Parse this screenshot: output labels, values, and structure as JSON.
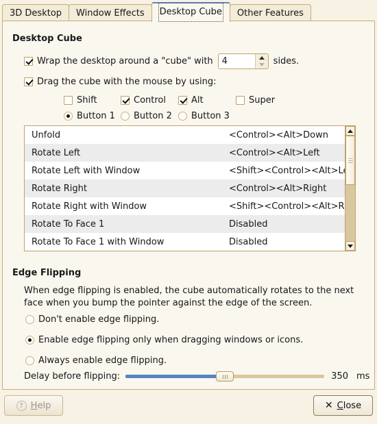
{
  "tabs": [
    {
      "label": "3D Desktop",
      "active": false
    },
    {
      "label": "Window Effects",
      "active": false
    },
    {
      "label": "Desktop Cube",
      "active": true
    },
    {
      "label": "Other Features",
      "active": false
    }
  ],
  "cube_group": {
    "title": "Desktop Cube",
    "wrap": {
      "checked": true,
      "label_before": "Wrap the desktop around a \"cube\" with",
      "sides_value": "4",
      "label_after": "sides."
    },
    "drag": {
      "checked": true,
      "label": "Drag the cube with the mouse by using:"
    },
    "modifiers": [
      {
        "label": "Shift",
        "checked": false
      },
      {
        "label": "Control",
        "checked": true
      },
      {
        "label": "Alt",
        "checked": true
      },
      {
        "label": "Super",
        "checked": false
      }
    ],
    "buttons": [
      {
        "label": "Button 1",
        "selected": true
      },
      {
        "label": "Button 2",
        "selected": false
      },
      {
        "label": "Button 3",
        "selected": false
      }
    ],
    "shortcuts": [
      {
        "action": "Unfold",
        "binding": "<Control><Alt>Down"
      },
      {
        "action": "Rotate Left",
        "binding": "<Control><Alt>Left"
      },
      {
        "action": "Rotate Left with Window",
        "binding": "<Shift><Control><Alt>Left"
      },
      {
        "action": "Rotate Right",
        "binding": "<Control><Alt>Right"
      },
      {
        "action": "Rotate Right with Window",
        "binding": "<Shift><Control><Alt>Right"
      },
      {
        "action": "Rotate To Face 1",
        "binding": "Disabled"
      },
      {
        "action": "Rotate To Face 1 with Window",
        "binding": "Disabled"
      }
    ]
  },
  "edge_group": {
    "title": "Edge Flipping",
    "description": "When edge flipping is enabled, the cube automatically rotates to the next face when you bump the pointer against the edge of the screen.",
    "options": [
      {
        "label": "Don't enable edge flipping.",
        "selected": false
      },
      {
        "label": "Enable edge flipping only when dragging windows or icons.",
        "selected": true
      },
      {
        "label": "Always enable edge flipping.",
        "selected": false
      }
    ],
    "delay": {
      "label": "Delay before flipping:",
      "value": "350",
      "unit": "ms",
      "percent": 50
    }
  },
  "footer": {
    "help_label": "Help",
    "help_accel": "H",
    "close_label": "Close",
    "close_accel": "C",
    "close_icon": "x-icon",
    "help_icon": "question-circle-icon"
  },
  "colors": {
    "background": "#faf7ef",
    "border": "#c8ab76",
    "accent": "#5585bd",
    "row_alt": "#ececec",
    "active_tab_top": "#5f87c4"
  }
}
